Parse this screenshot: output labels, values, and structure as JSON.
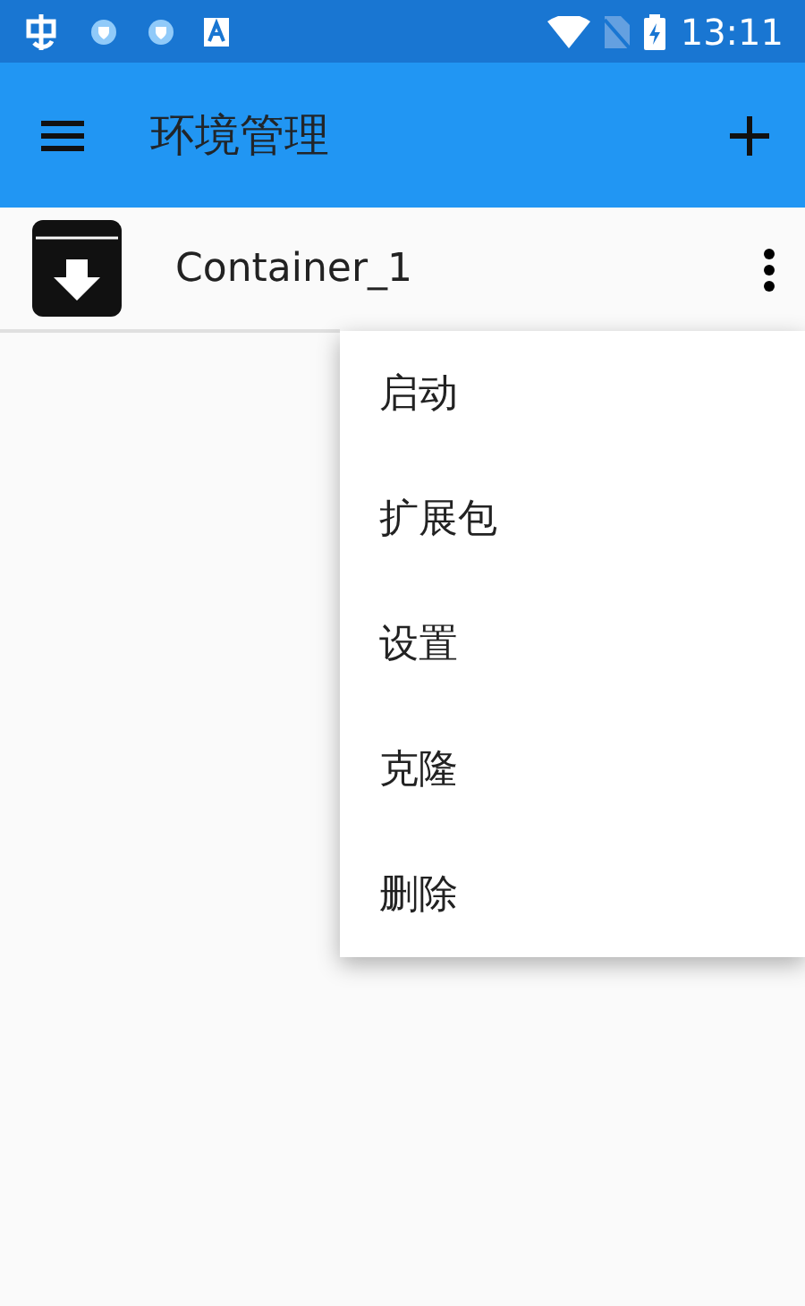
{
  "status_bar": {
    "time": "13:11"
  },
  "app_bar": {
    "title": "环境管理"
  },
  "containers": [
    {
      "name": "Container_1"
    }
  ],
  "menu": {
    "items": [
      {
        "label": "启动"
      },
      {
        "label": "扩展包"
      },
      {
        "label": "设置"
      },
      {
        "label": "克隆"
      },
      {
        "label": "删除"
      }
    ]
  }
}
